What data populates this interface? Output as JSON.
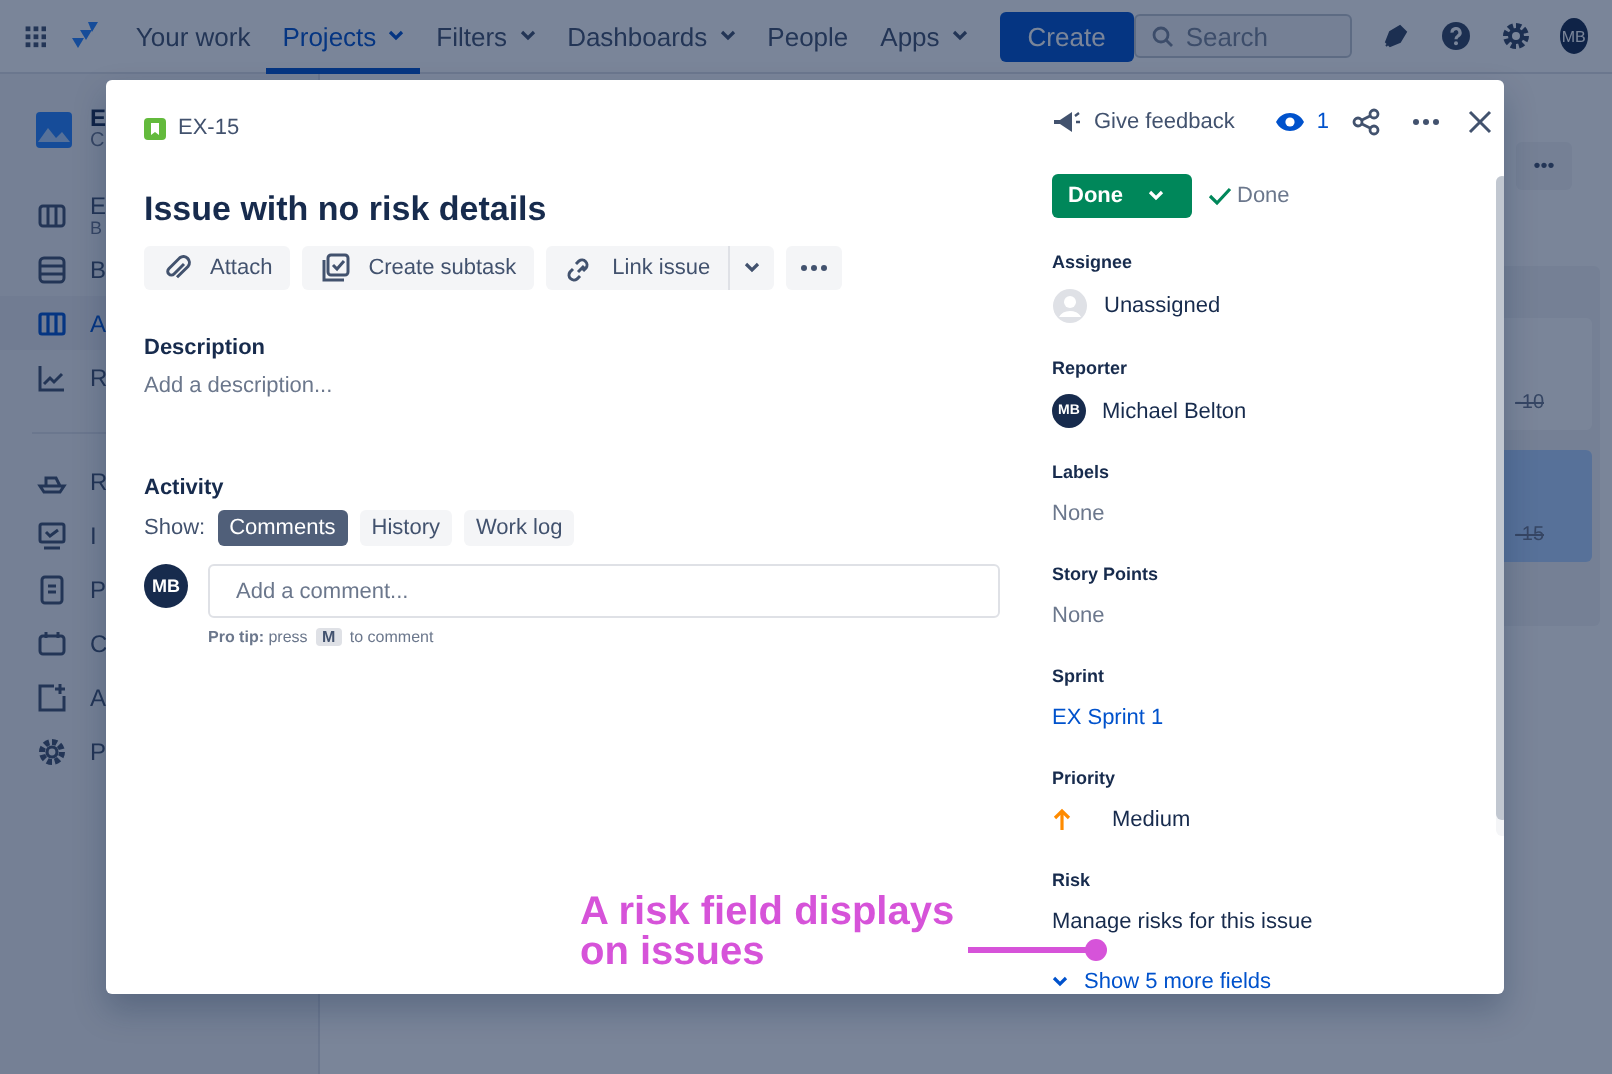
{
  "nav": {
    "items": [
      {
        "label": "Your work",
        "selected": false,
        "dropdown": false
      },
      {
        "label": "Projects",
        "selected": true,
        "dropdown": true
      },
      {
        "label": "Filters",
        "selected": false,
        "dropdown": true
      },
      {
        "label": "Dashboards",
        "selected": false,
        "dropdown": true
      },
      {
        "label": "People",
        "selected": false,
        "dropdown": false
      },
      {
        "label": "Apps",
        "selected": false,
        "dropdown": true
      }
    ],
    "create": "Create",
    "search": {
      "placeholder": "Search"
    },
    "avatar": "MB"
  },
  "sidebar": {
    "project": {
      "name": "E",
      "subtitle": "C"
    },
    "groups": [
      [
        {
          "label": "E",
          "subtitle": "B",
          "kind": "board",
          "selected": false
        },
        {
          "label": "B",
          "kind": "backlog",
          "selected": false
        },
        {
          "label": "A",
          "kind": "columns",
          "selected": true
        },
        {
          "label": "R",
          "kind": "chart",
          "selected": false
        }
      ],
      [
        {
          "label": "R",
          "kind": "ship",
          "selected": false
        },
        {
          "label": "I",
          "kind": "monitor",
          "selected": false
        },
        {
          "label": "P",
          "kind": "page",
          "selected": false
        },
        {
          "label": "C",
          "kind": "box",
          "selected": false
        },
        {
          "label": "A",
          "kind": "add",
          "selected": false
        },
        {
          "label": "P",
          "kind": "gear",
          "selected": false
        }
      ]
    ]
  },
  "board": {
    "more": "•••",
    "cards": [
      {
        "key": "-10",
        "selected": false
      },
      {
        "key": "-15",
        "selected": true
      }
    ]
  },
  "modal": {
    "issue_key": "EX-15",
    "feedback": "Give feedback",
    "watchers": "1",
    "title": "Issue with no risk details",
    "actions": [
      {
        "label": "Attach",
        "kind": "attach"
      },
      {
        "label": "Create subtask",
        "kind": "subtask"
      },
      {
        "label": "Link issue",
        "kind": "link"
      }
    ],
    "description": {
      "heading": "Description",
      "placeholder": "Add a description..."
    },
    "activity": {
      "heading": "Activity",
      "show_label": "Show:",
      "filters": [
        {
          "label": "Comments",
          "selected": true
        },
        {
          "label": "History",
          "selected": false
        },
        {
          "label": "Work log",
          "selected": false
        }
      ],
      "avatar": "MB",
      "comment_placeholder": "Add a comment...",
      "pro_tip": "**Pro tip:** press",
      "pro_tip_key": "M",
      "pro_tip_end": "to comment"
    },
    "status": {
      "button": "Done",
      "resolution": "Done"
    },
    "fields": [
      {
        "label": "Assignee",
        "value": "Unassigned",
        "kind": "empty-user"
      },
      {
        "label": "Reporter",
        "value": "Michael Belton",
        "kind": "user",
        "avatar": "MB"
      },
      {
        "label": "Labels",
        "value": "None",
        "kind": "none"
      },
      {
        "label": "Story Points",
        "value": "None",
        "kind": "none"
      },
      {
        "label": "Sprint",
        "value": "EX Sprint 1",
        "kind": "link"
      },
      {
        "label": "Priority",
        "value": "Medium",
        "kind": "priority"
      },
      {
        "label": "Risk",
        "value": "Manage risks for this issue",
        "kind": "text"
      }
    ],
    "show_more": "Show 5 more fields"
  },
  "callout": {
    "text": "A risk field displays on issues"
  }
}
